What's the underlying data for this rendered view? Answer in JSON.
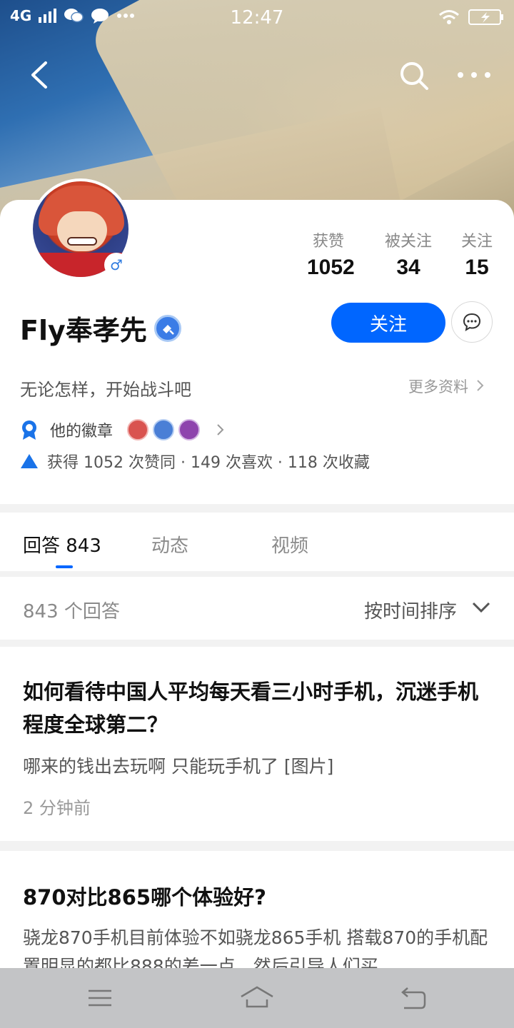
{
  "status_bar": {
    "network": "4G",
    "time": "12:47"
  },
  "profile": {
    "name": "Fly奉孝先",
    "bio": "无论怎样，开始战斗吧",
    "more_info": "更多资料",
    "gender_symbol": "♂",
    "stats": [
      {
        "label": "获赞",
        "value": "1052"
      },
      {
        "label": "被关注",
        "value": "34"
      },
      {
        "label": "关注",
        "value": "15"
      }
    ],
    "follow_label": "关注",
    "badges_label": "他的徽章",
    "achievements": "获得 1052 次赞同 · 149 次喜欢 · 118 次收藏"
  },
  "tabs": [
    {
      "label": "回答 843"
    },
    {
      "label": "动态"
    },
    {
      "label": "视频"
    }
  ],
  "sortbar": {
    "count": "843 个回答",
    "sort_label": "按时间排序"
  },
  "answers": [
    {
      "title": "如何看待中国人平均每天看三小时手机，沉迷手机程度全球第二？",
      "excerpt": "哪来的钱出去玩啊 只能玩手机了 [图片]",
      "time": "2 分钟前"
    },
    {
      "title": "870对比865哪个体验好?",
      "excerpt": "骁龙870手机目前体验不如骁龙865手机 搭载870的手机配置明显的都比888的差一点，然后引导人们买"
    }
  ],
  "colors": {
    "accent": "#0066ff",
    "badge_colors": [
      "#d9534f",
      "#4a7fd6",
      "#8e44ad"
    ]
  }
}
